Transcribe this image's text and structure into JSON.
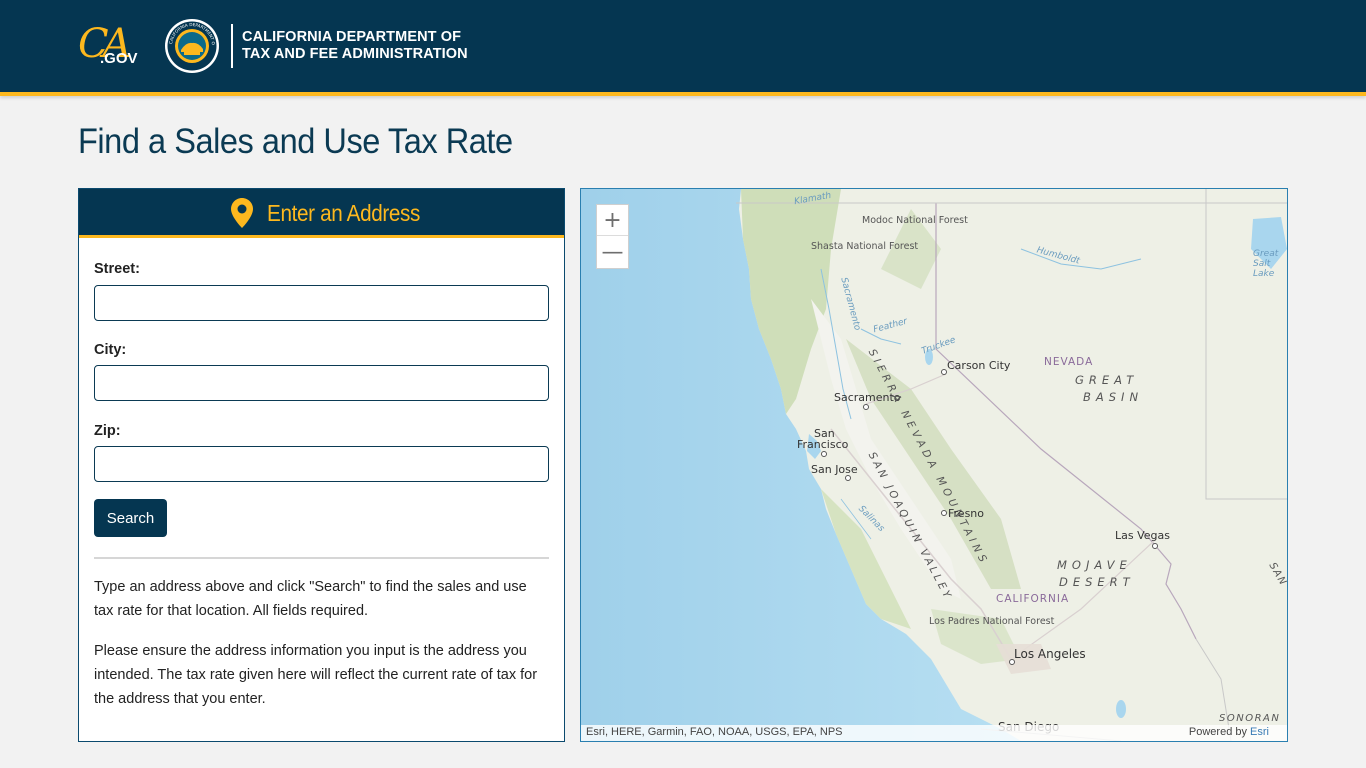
{
  "header": {
    "ca_logo_text": "CA",
    "gov_text": ".GOV",
    "agency_line1": "CALIFORNIA DEPARTMENT OF",
    "agency_line2": "TAX AND FEE ADMINISTRATION",
    "seal_text": "CALIFORNIA DEPARTMENT OF TAX AND FEE ADMINISTRATION"
  },
  "page_title": "Find a Sales and Use Tax Rate",
  "form": {
    "heading": "Enter an Address",
    "street_label": "Street:",
    "street_value": "",
    "city_label": "City:",
    "city_value": "",
    "zip_label": "Zip:",
    "zip_value": "",
    "search_label": "Search",
    "help_1": "Type an address above and click \"Search\" to find the sales and use tax rate for that location. All fields required.",
    "help_2": "Please ensure the address information you input is the address you intended. The tax rate given here will reflect the current rate of tax for the address that you enter."
  },
  "map": {
    "zoom_in": "+",
    "zoom_out": "—",
    "labels": {
      "carson_city": "Carson City",
      "nevada": "NEVADA",
      "great": "GREAT",
      "basin": "BASIN",
      "sacramento": "Sacramento",
      "san_francisco_1": "San",
      "san_francisco_2": "Francisco",
      "san_jose": "San Jose",
      "fresno": "Fresno",
      "las_vegas": "Las Vegas",
      "mojave": "MOJAVE",
      "desert": "DESERT",
      "california": "CALIFORNIA",
      "los_angeles": "Los Angeles",
      "san_diego": "San Diego",
      "sonoran": "SONORAN",
      "sierra_nevada": "SIERRA NEVADA MOUNTAINS",
      "san_joaquin": "SAN JOAQUIN VALLEY",
      "modoc": "Modoc National Forest",
      "shasta": "Shasta National Forest",
      "los_padres": "Los Padres National Forest",
      "klamath": "Klamath",
      "humboldt": "Humboldt",
      "sacramento_river": "Sacramento",
      "feather": "Feather",
      "truckee": "Truckee",
      "salinas": "Salinas",
      "great_salt_lake": "Great Salt Lake",
      "san_edge": "SAN"
    },
    "attribution_left": "Esri, HERE, Garmin, FAO, NOAA, USGS, EPA, NPS",
    "attribution_powered": "Powered by ",
    "attribution_esri": "Esri"
  },
  "colors": {
    "brand_navy": "#053651",
    "accent_gold": "#fdb81e",
    "page_bg": "#f2f2f2"
  }
}
